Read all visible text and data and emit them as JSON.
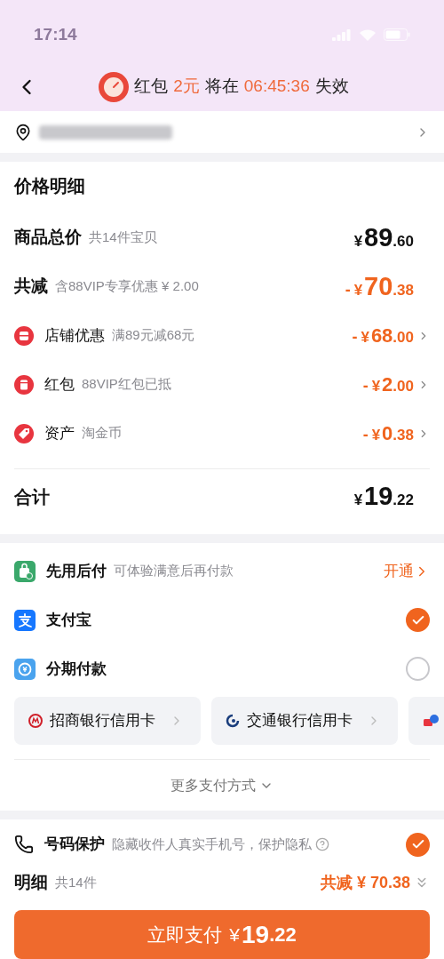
{
  "status_bar": {
    "time": "17:14"
  },
  "header": {
    "parts": [
      {
        "text": "红包",
        "highlight": false
      },
      {
        "text": "2元",
        "highlight": true
      },
      {
        "text": "将在",
        "highlight": false
      },
      {
        "text": "06:45:36",
        "highlight": true
      },
      {
        "text": "失效",
        "highlight": false
      }
    ]
  },
  "price_detail": {
    "title": "价格明细",
    "rows": [
      {
        "kind": "summary",
        "label": "商品总价",
        "note": "共14件宝贝",
        "sign": "",
        "currency": "¥",
        "amount": "89",
        "cents": ".60",
        "discount": false
      },
      {
        "kind": "summary",
        "label": "共减",
        "note": "含88VIP专享优惠 ¥ 2.00",
        "sign": "-",
        "currency": "¥",
        "amount": "70",
        "cents": ".38",
        "discount": true
      },
      {
        "kind": "item",
        "label": "店铺优惠",
        "note": "满89元减68元",
        "sign": "-",
        "currency": "¥",
        "amount": "68",
        "cents": ".00",
        "discount": true
      },
      {
        "kind": "item",
        "label": "红包",
        "note": "88VIP红包已抵",
        "sign": "-",
        "currency": "¥",
        "amount": "2",
        "cents": ".00",
        "discount": true
      },
      {
        "kind": "item",
        "label": "资产",
        "note": "淘金币",
        "sign": "-",
        "currency": "¥",
        "amount": "0",
        "cents": ".38",
        "discount": true
      }
    ],
    "total": {
      "label": "合计",
      "currency": "¥",
      "amount": "19",
      "cents": ".22"
    }
  },
  "payment": {
    "methods": [
      {
        "kind": "bnpl",
        "label": "先用后付",
        "note": "可体验满意后再付款",
        "action": "开通"
      },
      {
        "kind": "radio",
        "label": "支付宝",
        "selected": true
      },
      {
        "kind": "radio",
        "label": "分期付款",
        "selected": false
      }
    ],
    "banks": [
      {
        "label": "招商银行信用卡"
      },
      {
        "label": "交通银行信用卡"
      }
    ],
    "more": "更多支付方式"
  },
  "protection": {
    "label": "号码保护",
    "note": "隐藏收件人真实手机号，保护隐私",
    "checked": true
  },
  "summary": {
    "label": "明细",
    "count": "共14件",
    "saving": "共减 ¥ 70.38"
  },
  "pay_button": {
    "label": "立即支付",
    "currency": "¥",
    "amount": "19",
    "cents": ".22"
  }
}
